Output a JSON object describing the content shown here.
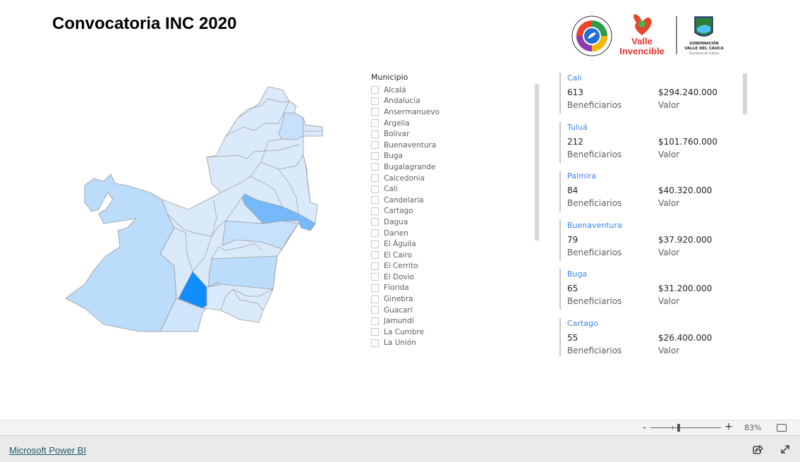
{
  "header": {
    "title": "Convocatoria INC 2020",
    "logos": {
      "seal_text": "Gobernación del Valle del Cauca - Secretaría de Cultura - Valle Invencible",
      "brand": "Valle Invencible",
      "gov_line1": "GOBERNACIÓN",
      "gov_line2": "VALLE DEL CAUCA",
      "gov_line3": "Secretaría de Cultura"
    }
  },
  "map": {
    "highlight_color": "#118dff",
    "secondary_color": "#76b9fa",
    "light_color": "#dbeafa",
    "mid_color": "#bcdcfc"
  },
  "slicer": {
    "title": "Municipio",
    "items": [
      "Alcalá",
      "Andalucía",
      "Ansermanuevo",
      "Argelia",
      "Bolivar",
      "Buenaventura",
      "Buga",
      "Bugalagrande",
      "Caicedonia",
      "Cali",
      "Candelaria",
      "Cartago",
      "Dagua",
      "Darien",
      "El Águila",
      "El Cairo",
      "El Cerrito",
      "El Dovio",
      "Florida",
      "Ginebra",
      "Guacarí",
      "Jamundí",
      "La Cumbre",
      "La Unión"
    ]
  },
  "cards": [
    {
      "municipio": "Cali",
      "beneficiarios": "613",
      "valor": "$294.240.000"
    },
    {
      "municipio": "Tuluá",
      "beneficiarios": "212",
      "valor": "$101.760.000"
    },
    {
      "municipio": "Palmira",
      "beneficiarios": "84",
      "valor": "$40.320.000"
    },
    {
      "municipio": "Buenaventura",
      "beneficiarios": "79",
      "valor": "$37.920.000"
    },
    {
      "municipio": "Buga",
      "beneficiarios": "65",
      "valor": "$31.200.000"
    },
    {
      "municipio": "Cartago",
      "beneficiarios": "55",
      "valor": "$26.400.000"
    }
  ],
  "card_labels": {
    "beneficiarios": "Beneficiarios",
    "valor": "Valor"
  },
  "zoom": {
    "minus": "-",
    "plus": "+",
    "level": "83%",
    "level_value": 83
  },
  "footer": {
    "link": "Microsoft Power BI"
  }
}
